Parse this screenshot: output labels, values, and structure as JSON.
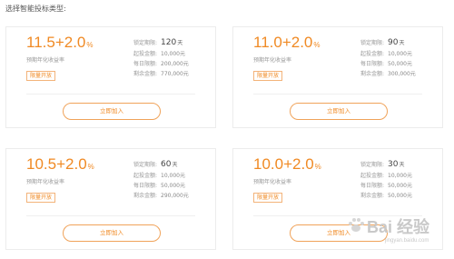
{
  "title": "选择智能投标类型:",
  "cards": [
    {
      "rate_main": "11.5+2.0",
      "rate_unit": "%",
      "rate_label": "预期年化收益率",
      "badge": "限量开放",
      "lock_label": "锁定期限:",
      "lock_value": "120",
      "lock_unit": "天",
      "start_label": "起投金额:",
      "start_value": "10,000元",
      "daily_label": "每日限额:",
      "daily_value": "200,000元",
      "remain_label": "剩余金额:",
      "remain_value": "770,000元",
      "button": "立即加入"
    },
    {
      "rate_main": "11.0+2.0",
      "rate_unit": "%",
      "rate_label": "预期年化收益率",
      "badge": "限量开放",
      "lock_label": "锁定期限:",
      "lock_value": "90",
      "lock_unit": "天",
      "start_label": "起投金额:",
      "start_value": "10,000元",
      "daily_label": "每日限额:",
      "daily_value": "50,000元",
      "remain_label": "剩余金额:",
      "remain_value": "300,000元",
      "button": "立即加入"
    },
    {
      "rate_main": "10.5+2.0",
      "rate_unit": "%",
      "rate_label": "预期年化收益率",
      "badge": "限量开放",
      "lock_label": "锁定期限:",
      "lock_value": "60",
      "lock_unit": "天",
      "start_label": "起投金额:",
      "start_value": "10,000元",
      "daily_label": "每日限额:",
      "daily_value": "50,000元",
      "remain_label": "剩余金额:",
      "remain_value": "290,000元",
      "button": "立即加入"
    },
    {
      "rate_main": "10.0+2.0",
      "rate_unit": "%",
      "rate_label": "预期年化收益率",
      "badge": "限量开放",
      "lock_label": "锁定期限:",
      "lock_value": "30",
      "lock_unit": "天",
      "start_label": "起投金额:",
      "start_value": "10,000元",
      "daily_label": "每日限额:",
      "daily_value": "50,000元",
      "remain_label": "剩余金额:",
      "remain_value": "50,000元",
      "button": "立即加入"
    }
  ],
  "watermark": {
    "text": "Bai 经验",
    "sub": "jingyan.baidu.com"
  },
  "colors": {
    "accent": "#f08a24",
    "border": "#ececec"
  }
}
